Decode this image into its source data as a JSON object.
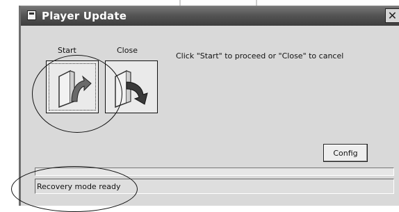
{
  "window": {
    "title": "Player Update",
    "close_glyph": "✕"
  },
  "buttons": {
    "start_label": "Start",
    "close_label": "Close",
    "config_label": "Config"
  },
  "icons": {
    "start": "folder-arrow-up-icon",
    "close": "folder-arrow-down-icon",
    "title": "app-window-icon"
  },
  "instruction": "Click \"Start\" to proceed or \"Close\" to cancel",
  "status": {
    "text": "Recovery mode ready",
    "progress": 0
  }
}
